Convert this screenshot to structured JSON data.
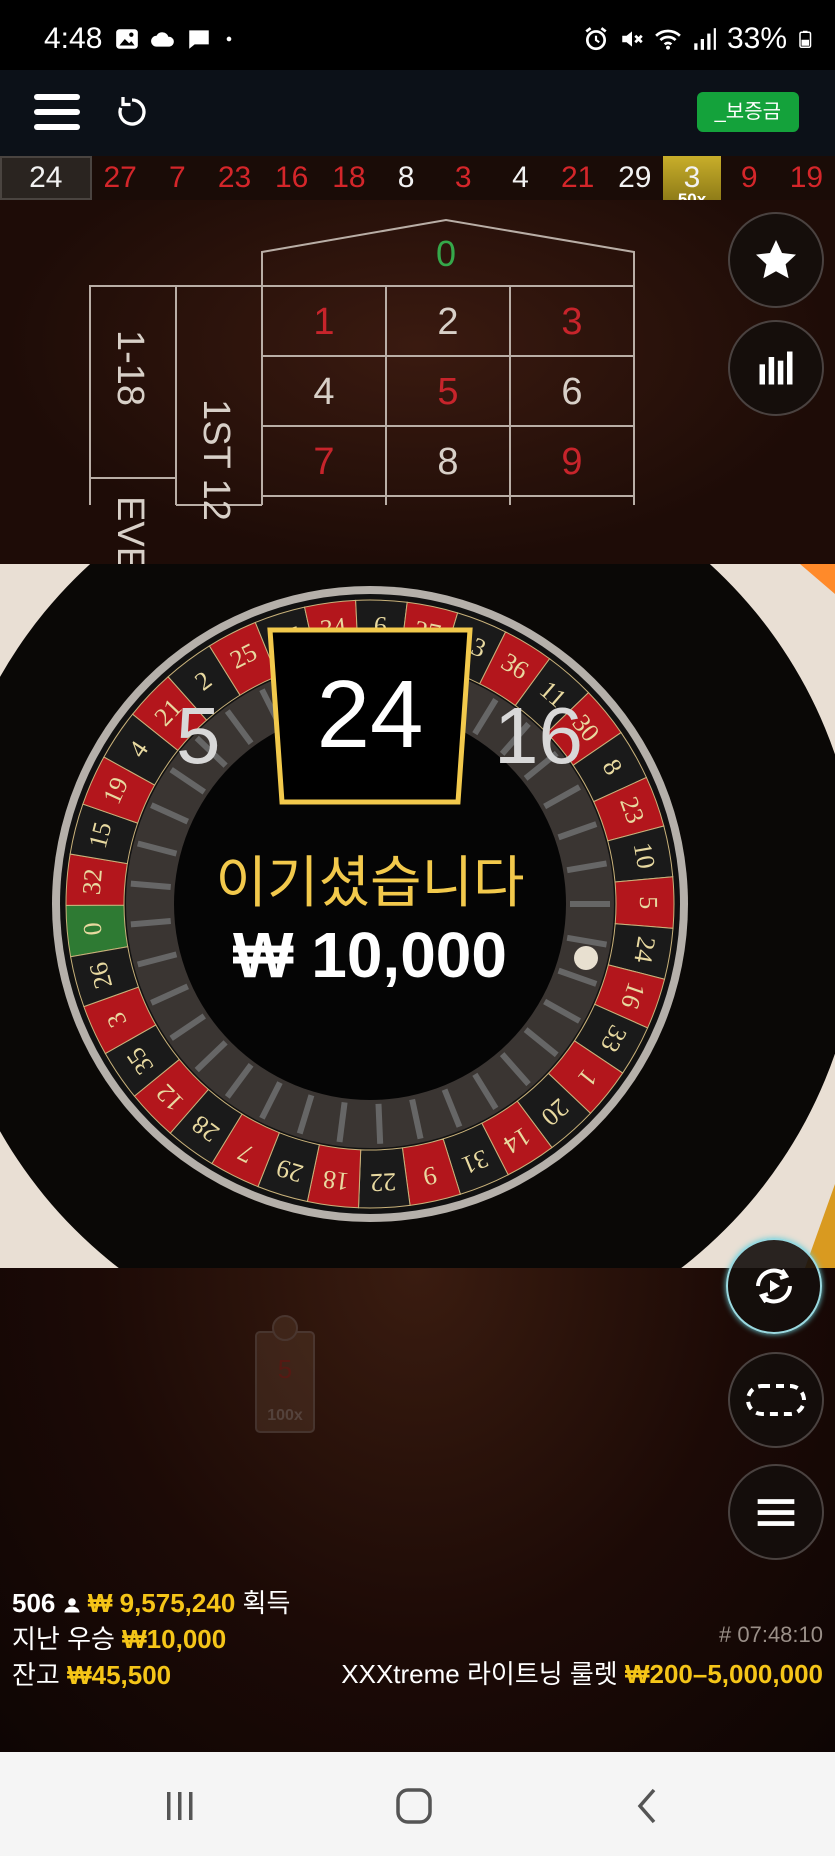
{
  "status_bar": {
    "time": "4:48",
    "battery": "33%",
    "left_icons": [
      "gallery-icon",
      "cloud-icon",
      "message-icon",
      "dot-icon"
    ],
    "right_icons": [
      "alarm-icon",
      "mute-icon",
      "wifi-icon",
      "signal-icon",
      "battery-icon"
    ]
  },
  "topbar": {
    "deposit_label": "_보증금",
    "deposit_color": "#14a23b"
  },
  "history": [
    {
      "n": "24",
      "color": "white"
    },
    {
      "n": "27",
      "color": "red"
    },
    {
      "n": "7",
      "color": "red"
    },
    {
      "n": "23",
      "color": "red"
    },
    {
      "n": "16",
      "color": "red"
    },
    {
      "n": "18",
      "color": "red"
    },
    {
      "n": "8",
      "color": "white"
    },
    {
      "n": "3",
      "color": "red"
    },
    {
      "n": "4",
      "color": "white"
    },
    {
      "n": "21",
      "color": "red"
    },
    {
      "n": "29",
      "color": "white"
    },
    {
      "n": "3",
      "color": "white",
      "multiplier": "50x"
    },
    {
      "n": "9",
      "color": "red"
    },
    {
      "n": "19",
      "color": "red"
    }
  ],
  "betting_table": {
    "zero": "0",
    "side_labels": [
      "1-18",
      "EVE"
    ],
    "dozen_label": "1ST 12",
    "rows": [
      [
        {
          "n": "1",
          "c": "red"
        },
        {
          "n": "2",
          "c": "white"
        },
        {
          "n": "3",
          "c": "red"
        }
      ],
      [
        {
          "n": "4",
          "c": "white"
        },
        {
          "n": "5",
          "c": "red"
        },
        {
          "n": "6",
          "c": "white"
        }
      ],
      [
        {
          "n": "7",
          "c": "red"
        },
        {
          "n": "8",
          "c": "white"
        },
        {
          "n": "9",
          "c": "red"
        }
      ]
    ]
  },
  "result": {
    "prev": "5",
    "current": "24",
    "next": "16",
    "win_title": "이기셨습니다",
    "win_amount": "₩ 10,000"
  },
  "wheel_numbers": [
    "0",
    "32",
    "15",
    "19",
    "4",
    "21",
    "2",
    "25",
    "17",
    "34",
    "6",
    "27",
    "13",
    "36",
    "11",
    "30",
    "8",
    "23",
    "10",
    "5",
    "24",
    "16",
    "33",
    "1",
    "20",
    "14",
    "31",
    "9",
    "22",
    "18",
    "29",
    "7",
    "28",
    "12",
    "35",
    "3",
    "26"
  ],
  "faded_card": {
    "number": "5",
    "multiplier": "100x"
  },
  "side_buttons": [
    "favorite-star",
    "statistics",
    "autoplay",
    "display-mode",
    "menu"
  ],
  "footer": {
    "players": "506",
    "total_won": "₩ 9,575,240",
    "total_won_suffix": "획득",
    "last_win_label": "지난 우승",
    "last_win_amount": "₩10,000",
    "balance_label": "잔고",
    "balance_amount": "₩45,500",
    "round_id": "# 07:48:10",
    "game_name": "XXXtreme 라이트닝 룰렛",
    "limits": "₩200–5,000,000"
  },
  "nav": [
    "recents-button",
    "home-button",
    "back-button"
  ]
}
